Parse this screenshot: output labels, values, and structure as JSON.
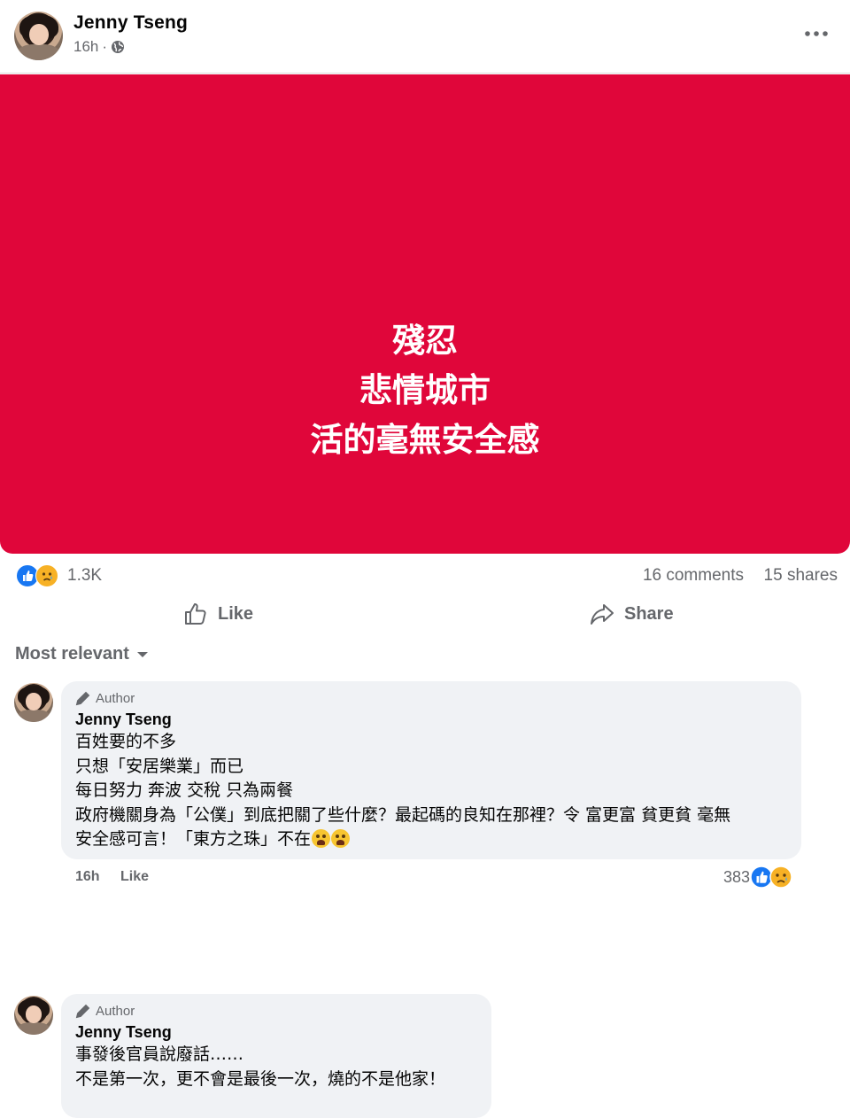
{
  "post": {
    "author": "Jenny Tseng",
    "time": "16h",
    "separator": "·",
    "privacy_icon": "globe-icon",
    "more_icon": "more-icon"
  },
  "banner": {
    "line1": "殘忍",
    "line2": "悲情城市",
    "line3": "活的毫無安全感",
    "background": "#e0063a"
  },
  "stats": {
    "reactions": "1.3K",
    "comments": "16 comments",
    "shares": "15 shares"
  },
  "actions": {
    "like": "Like",
    "share": "Share"
  },
  "sort": {
    "label": "Most relevant"
  },
  "comments": [
    {
      "badge": "Author",
      "author": "Jenny Tseng",
      "text": "百姓要的不多\n只想「安居樂業」而已\n每日努力 奔波 交稅 只為兩餐\n政府機關身為「公僕」到底把關了些什麼？最起碼的良知在那裡？令 富更富 貧更貧 毫無\n安全感可言！「東方之珠」不在",
      "time": "16h",
      "like": "Like",
      "reaction_count": "383"
    },
    {
      "badge": "Author",
      "author": "Jenny Tseng",
      "text": "事發後官員說廢話……\n不是第一次，更不會是最後一次，燒的不是他家！"
    }
  ]
}
